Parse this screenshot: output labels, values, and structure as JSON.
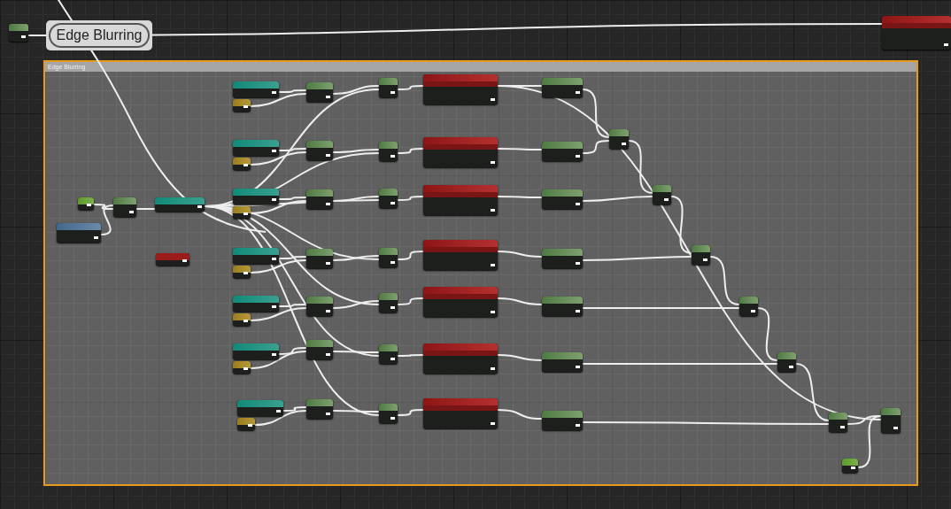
{
  "comment_bubble": {
    "text": "Edge Blurring"
  },
  "comment_box": {
    "title": "Edge Blurring",
    "selected": true
  },
  "nodes": [
    {
      "kind": "math"
    },
    {
      "kind": "texture"
    },
    {
      "kind": "scalar"
    },
    {
      "kind": "math"
    },
    {
      "kind": "param"
    },
    {
      "kind": "view"
    },
    {
      "kind": "coord"
    },
    {
      "kind": "param"
    },
    {
      "kind": "vector"
    },
    {
      "kind": "math"
    },
    {
      "kind": "math"
    },
    {
      "kind": "texture"
    },
    {
      "kind": "math"
    },
    {
      "kind": "param"
    },
    {
      "kind": "vector"
    },
    {
      "kind": "math"
    },
    {
      "kind": "math"
    },
    {
      "kind": "texture"
    },
    {
      "kind": "math"
    },
    {
      "kind": "param"
    },
    {
      "kind": "vector"
    },
    {
      "kind": "math"
    },
    {
      "kind": "math"
    },
    {
      "kind": "texture"
    },
    {
      "kind": "math"
    },
    {
      "kind": "param"
    },
    {
      "kind": "vector"
    },
    {
      "kind": "math"
    },
    {
      "kind": "math"
    },
    {
      "kind": "texture"
    },
    {
      "kind": "math"
    },
    {
      "kind": "param"
    },
    {
      "kind": "vector"
    },
    {
      "kind": "math"
    },
    {
      "kind": "math"
    },
    {
      "kind": "texture"
    },
    {
      "kind": "math"
    },
    {
      "kind": "param"
    },
    {
      "kind": "vector"
    },
    {
      "kind": "math"
    },
    {
      "kind": "math"
    },
    {
      "kind": "texture"
    },
    {
      "kind": "math"
    },
    {
      "kind": "param"
    },
    {
      "kind": "vector"
    },
    {
      "kind": "math"
    },
    {
      "kind": "math"
    },
    {
      "kind": "texture"
    },
    {
      "kind": "math"
    },
    {
      "kind": "math"
    },
    {
      "kind": "math"
    },
    {
      "kind": "math"
    },
    {
      "kind": "math"
    },
    {
      "kind": "math"
    },
    {
      "kind": "math"
    },
    {
      "kind": "math"
    },
    {
      "kind": "scalar"
    }
  ]
}
